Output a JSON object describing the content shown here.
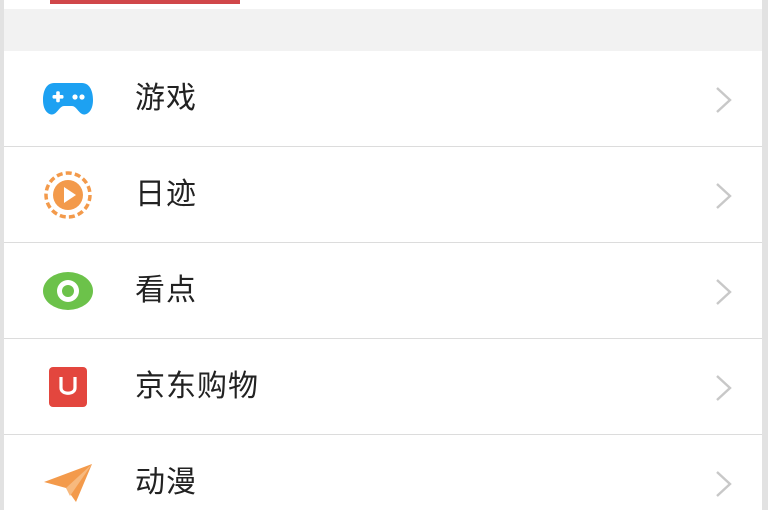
{
  "menu": {
    "items": [
      {
        "label": "游戏",
        "icon": "gamepad-icon",
        "color": "#1da1f2"
      },
      {
        "label": "日迹",
        "icon": "play-circle-icon",
        "color": "#f39a4b"
      },
      {
        "label": "看点",
        "icon": "eye-icon",
        "color": "#6cc24a"
      },
      {
        "label": "京东购物",
        "icon": "jd-shopping-bag-icon",
        "color": "#e3463e"
      },
      {
        "label": "动漫",
        "icon": "paper-plane-icon",
        "color": "#f39a4b"
      }
    ]
  },
  "colors": {
    "top_accent": "#d0474a",
    "separator": "#dcdcdc",
    "chevron": "#c8c8c8"
  }
}
